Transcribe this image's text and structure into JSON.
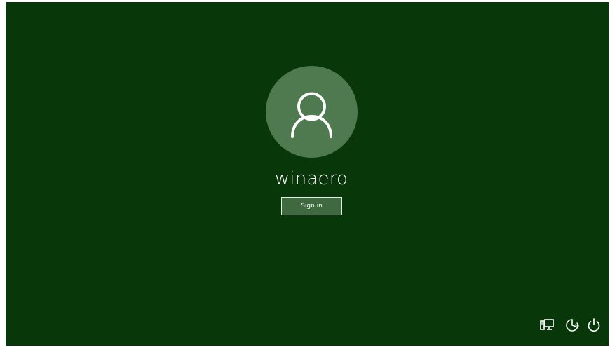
{
  "login": {
    "username": "winaero",
    "signin_label": "Sign in",
    "avatar_icon": "user-silhouette-icon"
  },
  "tray": {
    "icons": [
      "network-icon",
      "ease-of-access-icon",
      "power-icon"
    ]
  },
  "colors": {
    "background": "#083709",
    "avatar_circle": "#4f7a4f",
    "button_fill": "#3f6a3f",
    "foreground": "#ffffff"
  }
}
